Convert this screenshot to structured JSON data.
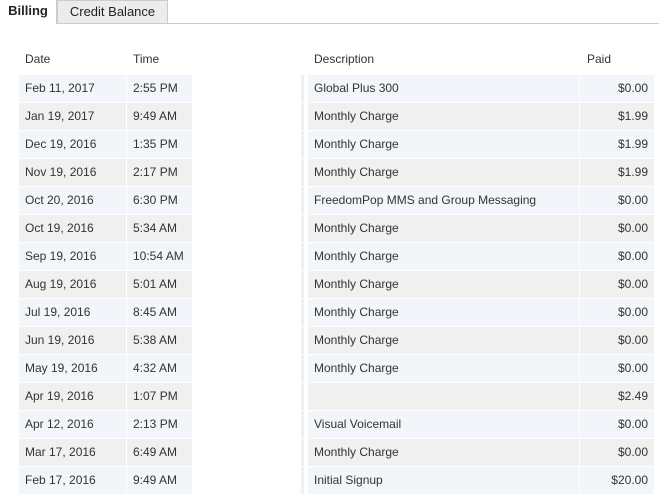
{
  "tabs": [
    {
      "label": "Billing",
      "active": true
    },
    {
      "label": "Credit Balance",
      "active": false
    }
  ],
  "table": {
    "columns": {
      "date": "Date",
      "time": "Time",
      "description": "Description",
      "paid": "Paid"
    },
    "rows": [
      {
        "date": "Feb 11, 2017",
        "time": "2:55 PM",
        "description": "Global Plus 300",
        "paid": "$0.00"
      },
      {
        "date": "Jan 19, 2017",
        "time": "9:49 AM",
        "description": "Monthly Charge",
        "paid": "$1.99"
      },
      {
        "date": "Dec 19, 2016",
        "time": "1:35 PM",
        "description": "Monthly Charge",
        "paid": "$1.99"
      },
      {
        "date": "Nov 19, 2016",
        "time": "2:17 PM",
        "description": "Monthly Charge",
        "paid": "$1.99"
      },
      {
        "date": "Oct 20, 2016",
        "time": "6:30 PM",
        "description": "FreedomPop MMS and Group Messaging",
        "paid": "$0.00"
      },
      {
        "date": "Oct 19, 2016",
        "time": "5:34 AM",
        "description": "Monthly Charge",
        "paid": "$0.00"
      },
      {
        "date": "Sep 19, 2016",
        "time": "10:54 AM",
        "description": "Monthly Charge",
        "paid": "$0.00"
      },
      {
        "date": "Aug 19, 2016",
        "time": "5:01 AM",
        "description": "Monthly Charge",
        "paid": "$0.00"
      },
      {
        "date": "Jul 19, 2016",
        "time": "8:45 AM",
        "description": "Monthly Charge",
        "paid": "$0.00"
      },
      {
        "date": "Jun 19, 2016",
        "time": "5:38 AM",
        "description": "Monthly Charge",
        "paid": "$0.00"
      },
      {
        "date": "May 19, 2016",
        "time": "4:32 AM",
        "description": "Monthly Charge",
        "paid": "$0.00"
      },
      {
        "date": "Apr 19, 2016",
        "time": "1:07 PM",
        "description": "",
        "paid": "$2.49"
      },
      {
        "date": "Apr 12, 2016",
        "time": "2:13 PM",
        "description": "Visual Voicemail",
        "paid": "$0.00"
      },
      {
        "date": "Mar 17, 2016",
        "time": "6:49 AM",
        "description": "Monthly Charge",
        "paid": "$0.00"
      },
      {
        "date": "Feb 17, 2016",
        "time": "9:49 AM",
        "description": "Initial Signup",
        "paid": "$20.00"
      }
    ]
  }
}
